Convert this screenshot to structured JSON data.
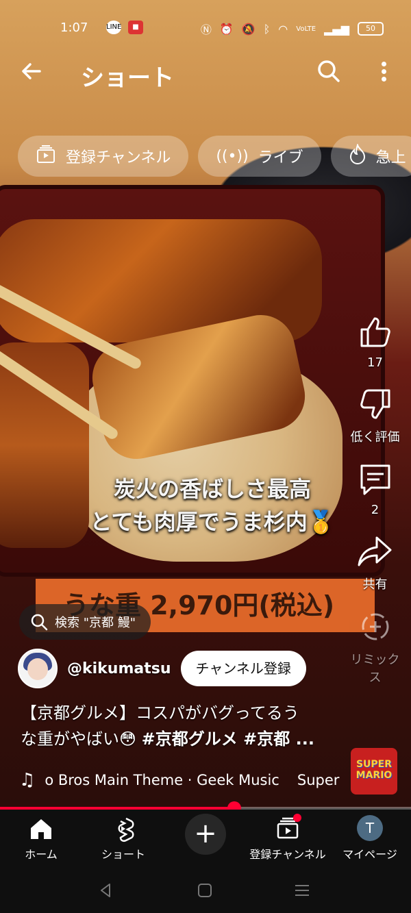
{
  "status_bar": {
    "time": "1:07",
    "battery": "50",
    "left_icons": [
      "line-icon",
      "app-badge-icon"
    ],
    "right_icons": [
      "nfc-icon",
      "alarm-icon",
      "mute-icon",
      "bluetooth-icon",
      "wifi-icon",
      "volte-icon",
      "signal-icon",
      "battery-icon"
    ]
  },
  "header": {
    "title": "ショート",
    "back_icon": "back-arrow-icon",
    "search_icon": "search-icon",
    "more_icon": "more-vert-icon"
  },
  "chips": [
    {
      "label": "登録チャンネル",
      "icon": "subscriptions-icon"
    },
    {
      "label": "ライブ",
      "icon": "live-icon"
    },
    {
      "label": "急上",
      "icon": "trending-icon"
    }
  ],
  "video": {
    "caption_line1": "炭火の香ばしさ最高",
    "caption_line2": "とても肉厚でうま杉内🥇",
    "price_banner": "うな重 2,970円(税込)"
  },
  "rail": {
    "like_count": "17",
    "dislike_label": "低く評価",
    "comment_count": "2",
    "share_label": "共有",
    "remix_label": "リミックス"
  },
  "search_hint": "検索 \"京都 鰻\"",
  "channel": {
    "handle": "@kikumatsu",
    "subscribe_label": "チャンネル登録"
  },
  "description": {
    "line1": "【京都グルメ】コスパがバグってるう",
    "line2_prefix": "な重がやばい😳 ",
    "hashtags": "#京都グルメ #京都 ..."
  },
  "music": {
    "track": "o Bros Main Theme · Geek Music",
    "track_next": "Super",
    "album_text": "SUPER MARIO"
  },
  "progress": {
    "fraction": 0.57
  },
  "bottom_nav": {
    "home": "ホーム",
    "shorts": "ショート",
    "subscriptions": "登録チャンネル",
    "mypage": "マイページ",
    "avatar_letter": "T"
  },
  "colors": {
    "accent": "#ff0033",
    "nav_bg": "#0f0f0f",
    "banner": "#e56a2a"
  }
}
